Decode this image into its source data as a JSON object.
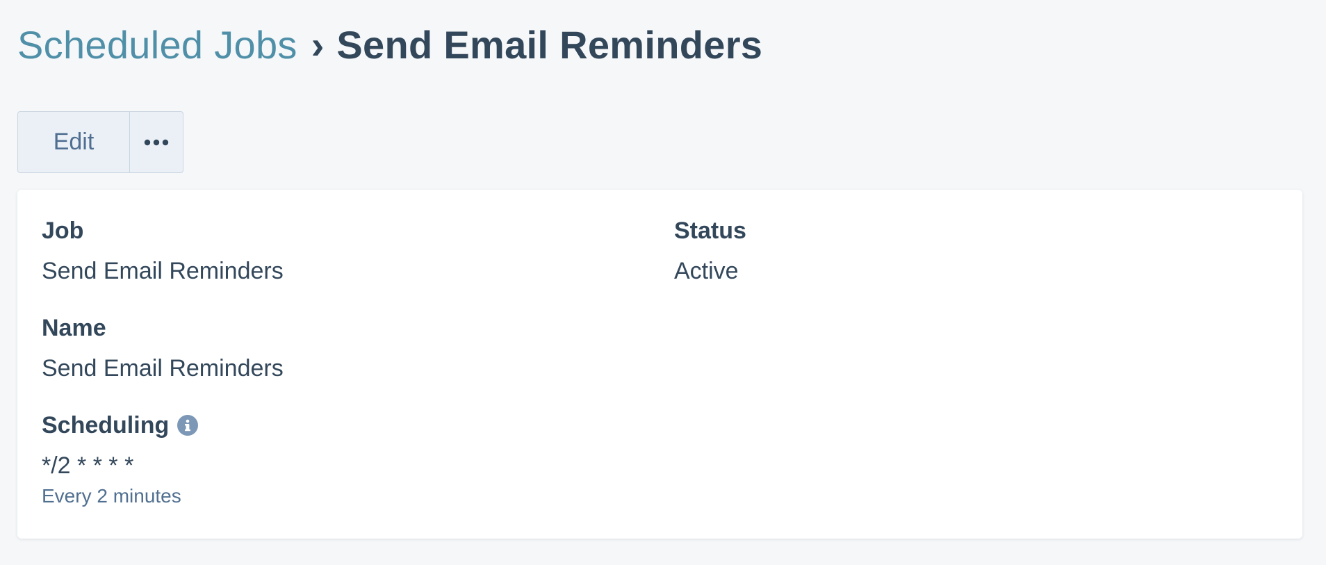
{
  "breadcrumb": {
    "parent": "Scheduled Jobs",
    "separator": "›",
    "current": "Send Email Reminders"
  },
  "toolbar": {
    "edit_label": "Edit",
    "more_icon": "more-horizontal-icon"
  },
  "details": {
    "job": {
      "label": "Job",
      "value": "Send Email Reminders"
    },
    "status": {
      "label": "Status",
      "value": "Active"
    },
    "name": {
      "label": "Name",
      "value": "Send Email Reminders"
    },
    "scheduling": {
      "label": "Scheduling",
      "value": "*/2 * * * *",
      "description": "Every 2 minutes",
      "icon": "info-icon"
    }
  },
  "colors": {
    "link": "#4f8fa8",
    "text": "#33475b",
    "muted": "#516f90",
    "background": "#f5f7f9",
    "button_bg": "#eaf0f6",
    "border": "#cbd6e2"
  }
}
